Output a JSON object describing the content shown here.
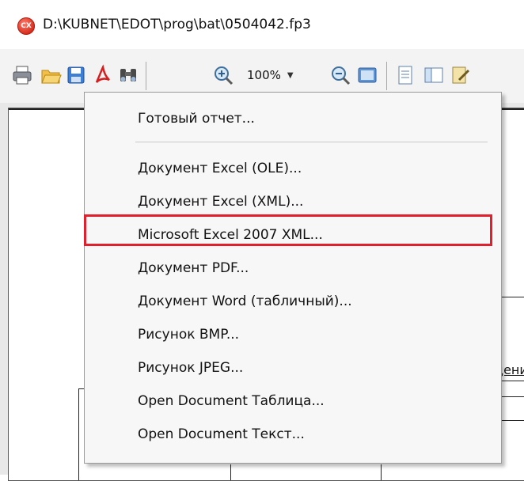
{
  "window": {
    "title": "D:\\KUBNET\\EDOT\\prog\\bat\\0504042.fp3",
    "app_icon_text": "CX"
  },
  "toolbar": {
    "icons": [
      "print-icon",
      "open-folder-icon",
      "save-icon",
      "pdf-icon",
      "find-icon",
      "zoom-in-icon",
      "zoom-out-icon",
      "page-view-icon",
      "page-setup-icon",
      "outline-icon",
      "edit-icon"
    ],
    "zoom_value": "100%"
  },
  "document": {
    "fragment_text": "дени"
  },
  "export_menu": {
    "items": [
      {
        "label": "Готовый отчет..."
      },
      {
        "label": "Документ Excel (OLE)..."
      },
      {
        "label": "Документ Excel (XML)..."
      },
      {
        "label": "Microsoft Excel 2007 XML..."
      },
      {
        "label": "Документ PDF..."
      },
      {
        "label": "Документ Word (табличный)..."
      },
      {
        "label": "Рисунок BMP..."
      },
      {
        "label": "Рисунок JPEG..."
      },
      {
        "label": "Open Document Таблица..."
      },
      {
        "label": "Open Document Текст..."
      }
    ],
    "highlighted_item": "Microsoft Excel 2007 XML...",
    "highlight_color": "#e0202c"
  }
}
